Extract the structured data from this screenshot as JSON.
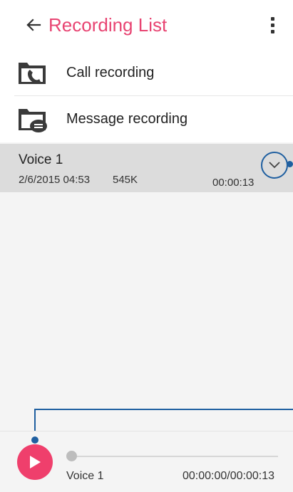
{
  "appbar": {
    "title": "Recording List",
    "back_icon": "arrow-left-icon",
    "more_icon": "more-vertical-icon"
  },
  "folders": [
    {
      "label": "Call recording",
      "icon": "call-folder-icon"
    },
    {
      "label": "Message recording",
      "icon": "message-folder-icon"
    }
  ],
  "recording": {
    "name": "Voice 1",
    "date": "2/6/2015 04:53",
    "size": "545K",
    "duration": "00:00:13",
    "expand_icon": "chevron-down-icon"
  },
  "player": {
    "name": "Voice 1",
    "time": "00:00:00/00:00:13",
    "progress": 0,
    "play_icon": "play-icon"
  },
  "colors": {
    "accent": "#e84472",
    "play": "#ef3f6c",
    "annotation": "#1f5fa0",
    "selected_row": "#dcdcdc"
  }
}
